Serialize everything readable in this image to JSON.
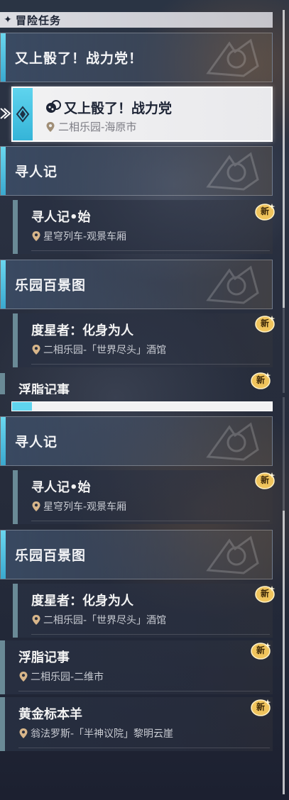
{
  "header": {
    "title": "冒险任务",
    "icon": "diamond-sparkle-icon"
  },
  "top_category": {
    "title": "又上骰了！战力党！"
  },
  "selected_quest": {
    "title": "又上骰了！战力党",
    "location": "二相乐园-海原市",
    "icon": "dice-icon"
  },
  "list_a": {
    "categories": [
      {
        "title": "寻人记",
        "quests": [
          {
            "title": "寻人记•始",
            "location": "星穹列车-观景车厢",
            "badge": "新"
          }
        ]
      },
      {
        "title": "乐园百景图",
        "quests": [
          {
            "title": "度星者：化身为人",
            "location": "二相乐园-「世界尽头」酒馆",
            "badge": "新"
          }
        ]
      }
    ],
    "partial_quest": {
      "title": "浮脂记事",
      "badge": "新"
    }
  },
  "list_b": {
    "categories": [
      {
        "title": "寻人记",
        "quests": [
          {
            "title": "寻人记•始",
            "location": "星穹列车-观景车厢",
            "badge": "新"
          }
        ]
      },
      {
        "title": "乐园百景图",
        "quests": [
          {
            "title": "度星者：化身为人",
            "location": "二相乐园-「世界尽头」酒馆",
            "badge": "新"
          },
          {
            "title": "浮脂记事",
            "location": "二相乐园-二维市",
            "badge": "新"
          },
          {
            "title": "黄金标本羊",
            "location": "翁法罗斯-「半神议院」黎明云崖",
            "badge": "新"
          }
        ]
      }
    ]
  },
  "colors": {
    "accent": "#5fd4ee",
    "badge": "#e8b54a",
    "selected_bg": "#f2f2f3"
  }
}
